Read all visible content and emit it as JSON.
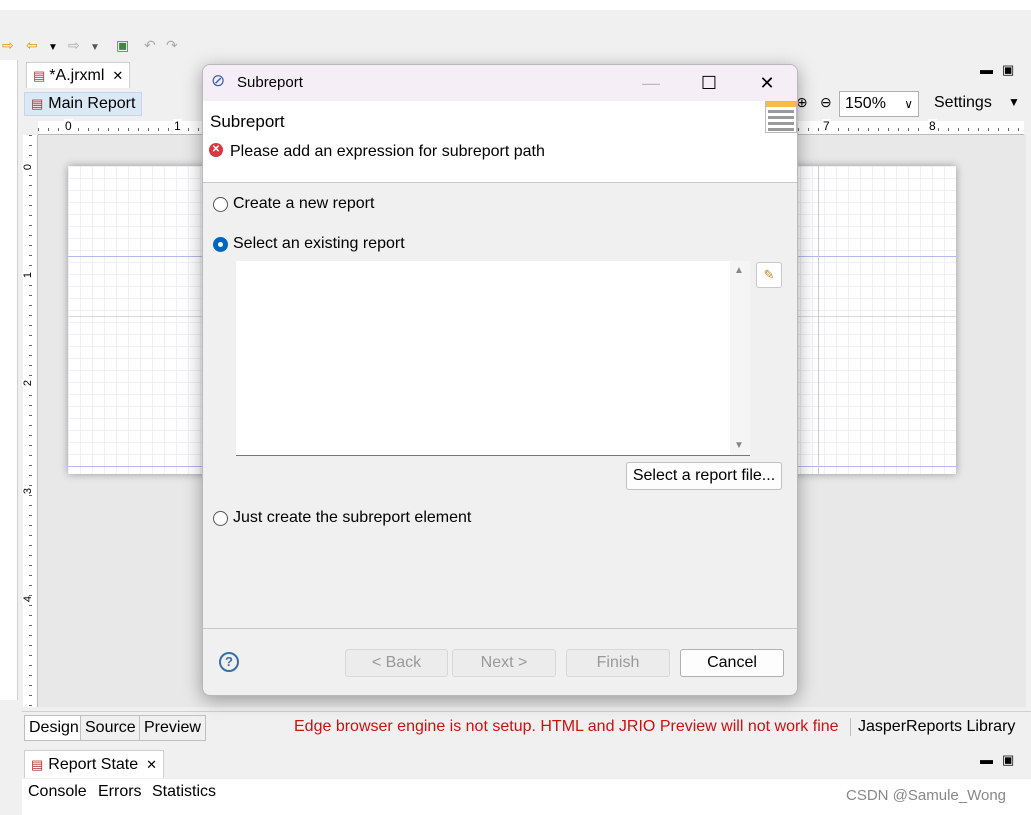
{
  "editor": {
    "file_tab": "*A.jrxml",
    "report_tab": "Main Report",
    "zoom_value": "150%",
    "settings_label": "Settings",
    "ruler_top_labels": [
      "0",
      "1",
      "7",
      "8"
    ],
    "ruler_left_labels": [
      "0",
      "1",
      "2",
      "3",
      "4"
    ]
  },
  "bottom_tabs": {
    "design": "Design",
    "source": "Source",
    "preview": "Preview",
    "warning": "Edge browser engine is not setup. HTML and JRIO Preview will not work fine",
    "library": "JasperReports Library"
  },
  "state_panel": {
    "tab": "Report State",
    "console": "Console",
    "errors": "Errors",
    "statistics": "Statistics"
  },
  "watermark": "CSDN @Samule_Wong",
  "dialog": {
    "window_title": "Subreport",
    "heading": "Subreport",
    "error_message": "Please add an expression for subreport path",
    "options": [
      {
        "label": "Create a new report",
        "checked": false
      },
      {
        "label": "Select an existing report",
        "checked": true
      },
      {
        "label": "Just create the subreport element",
        "checked": false
      }
    ],
    "select_file_button": "Select a report file...",
    "buttons": {
      "back": "< Back",
      "next": "Next >",
      "finish": "Finish",
      "cancel": "Cancel"
    }
  },
  "colors": {
    "warning_text": "#cc1111",
    "radio_accent": "#0067c0",
    "title_bar": "#f5eef7"
  }
}
